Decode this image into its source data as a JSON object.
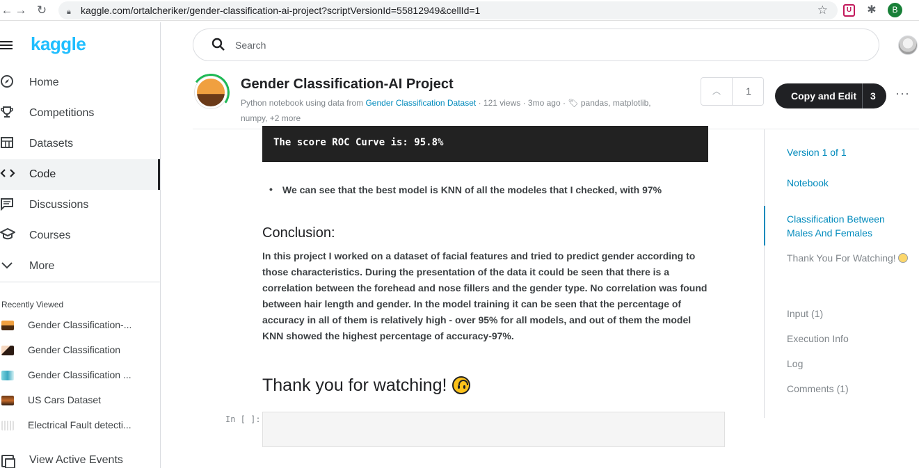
{
  "browser": {
    "url": "kaggle.com/ortalcheriker/gender-classification-ai-project?scriptVersionId=55812949&cellId=1",
    "profile_initial": "B"
  },
  "sidebar": {
    "logo": "kaggle",
    "nav": [
      {
        "label": "Home",
        "icon": "compass-icon"
      },
      {
        "label": "Competitions",
        "icon": "trophy-icon"
      },
      {
        "label": "Datasets",
        "icon": "table-icon"
      },
      {
        "label": "Code",
        "icon": "code-icon"
      },
      {
        "label": "Discussions",
        "icon": "comments-icon"
      },
      {
        "label": "Courses",
        "icon": "graduation-cap-icon"
      },
      {
        "label": "More",
        "icon": "chevron-down-icon"
      }
    ],
    "recent_title": "Recently Viewed",
    "recent": [
      {
        "label": "Gender Classification-..."
      },
      {
        "label": "Gender Classification"
      },
      {
        "label": "Gender Classification ..."
      },
      {
        "label": "US Cars Dataset"
      },
      {
        "label": "Electrical Fault detecti..."
      }
    ],
    "events_label": "View Active Events"
  },
  "search": {
    "placeholder": "Search"
  },
  "notebook": {
    "title": "Gender Classification-AI Project",
    "meta_prefix": "Python notebook using data from",
    "meta_dataset": "Gender Classification Dataset",
    "meta_suffix": "· 121 views · 3mo ago · ",
    "meta_tags": "pandas, matplotlib,",
    "meta_tags_more": "numpy, +2 more",
    "vote_count": "1",
    "copy_edit_label": "Copy and Edit",
    "copy_edit_count": "3"
  },
  "content": {
    "output_text": "The score ROC Curve is: 95.8%",
    "bullet_text": "We can see that the best model is KNN of all the modeles that I checked, with 97%",
    "conclusion_heading": "Conclusion:",
    "conclusion_text": "In this project I worked on a dataset of facial features and tried to predict gender according to those characteristics. During the presentation of the data it could be seen that there is a correlation between the forehead and nose fillers and the gender type. No correlation was found between hair length and gender. In the model training it can be seen that the percentage of accuracy in all of them is relatively high - over 95% for all models, and out of them the model KNN showed the highest percentage of accuracy-97%.",
    "thanks_heading": "Thank you for watching!",
    "in_prompt": "In [ ]:"
  },
  "toc": {
    "version": "Version 1 of 1",
    "notebook": "Notebook",
    "section_active": "Classification Between Males And Females",
    "section_thanks": "Thank You For Watching!",
    "input": "Input (1)",
    "execution_info": "Execution Info",
    "log": "Log",
    "comments": "Comments (1)"
  }
}
